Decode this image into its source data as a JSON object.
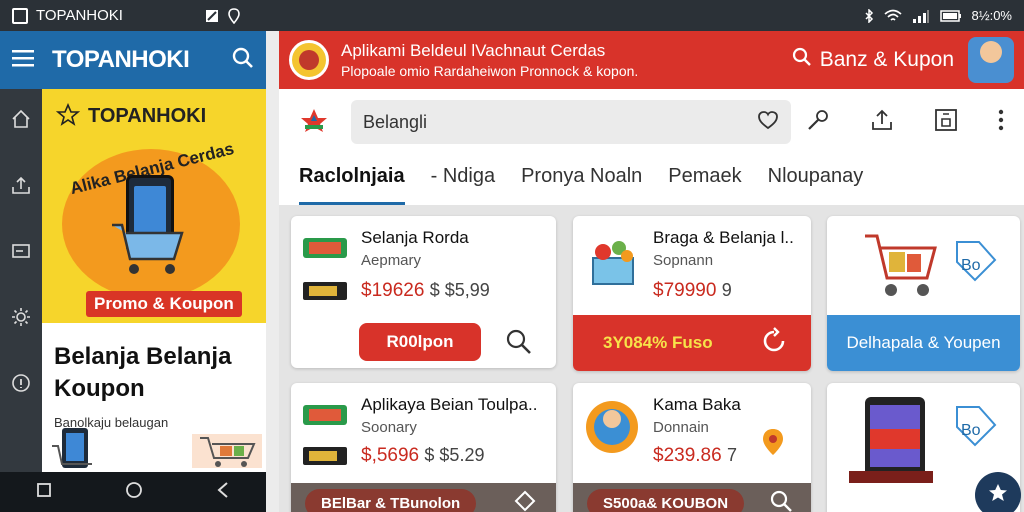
{
  "status_bar": {
    "app_name": "TOPANHOKI",
    "battery": "8½:0%"
  },
  "left_panel": {
    "brand": "TOPANHOKI",
    "banner": {
      "brand": "TOPANHOKI",
      "arc_text": "Alika Belanja Cerdas",
      "promo": "Promo & Koupon"
    },
    "title": "Belanja Belanja Koupon",
    "subtitle": "Banolkaju belaugan"
  },
  "header": {
    "title": "Aplikami Beldeul lVachnaut Cerdas",
    "subtitle": "Plopoale omio Rardaheiwon Pronnock & kopon.",
    "search_coupon_label": "Banz & Kupon"
  },
  "search": {
    "value": "Belangli"
  },
  "tabs": [
    {
      "label": "Raclolnjaia"
    },
    {
      "label": "- Ndiga"
    },
    {
      "label": "Pronya Noaln"
    },
    {
      "label": "Pemaek"
    },
    {
      "label": "Nloupanay"
    }
  ],
  "cards": [
    {
      "title": "Selanja Rorda",
      "subtitle": "Aepmary",
      "price": "$19626",
      "old_price": "$ $5,99",
      "button": "R00lpon"
    },
    {
      "title": "Braga & Belanja l..",
      "subtitle": "Sopnann",
      "price": "$79990",
      "old_price": "9",
      "bar": "3Y084% Fuso"
    },
    {
      "banner": "Delhapala & Youpen",
      "tag": "Bo"
    },
    {
      "title": "Aplikaya Beian Toulpa..",
      "subtitle": "Soonary",
      "price": "$,5696",
      "old_price": "$ $5.29",
      "bar": "BElBar & TBunolon"
    },
    {
      "title": "Kama Baka",
      "subtitle": "Donnain",
      "price": "$239.86",
      "old_price": "7",
      "bar": "S500a& KOUBON"
    },
    {
      "banner": "",
      "tag": "Bo"
    }
  ],
  "colors": {
    "primary_red": "#d8332a",
    "primary_blue": "#1f6aa8",
    "banner_yellow": "#f6d52b"
  }
}
